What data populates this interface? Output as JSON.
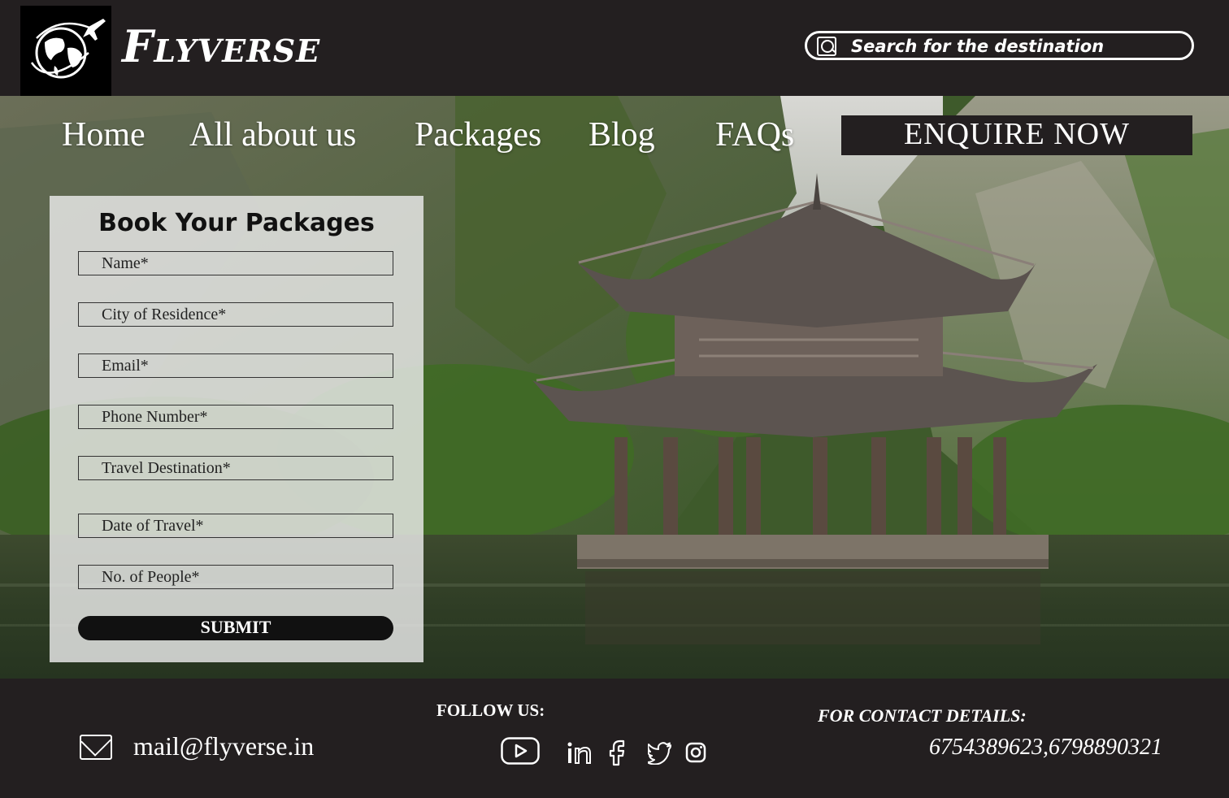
{
  "brand": {
    "name": "Flyverse"
  },
  "search": {
    "placeholder": "Search for the destination",
    "icon": "search-icon"
  },
  "nav": {
    "items": [
      {
        "label": "Home"
      },
      {
        "label": "All about us"
      },
      {
        "label": "Packages"
      },
      {
        "label": "Blog"
      },
      {
        "label": "FAQs"
      }
    ],
    "cta_label": "ENQUIRE NOW"
  },
  "form": {
    "title": "Book Your Packages",
    "fields": [
      {
        "label": "Name*"
      },
      {
        "label": "City of Residence*"
      },
      {
        "label": "Email*"
      },
      {
        "label": "Phone Number*"
      },
      {
        "label": "Travel Destination*"
      },
      {
        "label": "Date of Travel*"
      },
      {
        "label": "No. of People*"
      }
    ],
    "submit_label": "SUBMIT"
  },
  "footer": {
    "email": "mail@flyverse.in",
    "follow_label": "FOLLOW US:",
    "social_icons": [
      "youtube-icon",
      "linkedin-icon",
      "facebook-icon",
      "twitter-icon",
      "instagram-icon"
    ],
    "contact_label": "FOR CONTACT DETAILS:",
    "phones": "6754389623,6798890321"
  },
  "colors": {
    "dark": "#231f20",
    "form_bg": "#ebebeb",
    "button": "#111111"
  }
}
